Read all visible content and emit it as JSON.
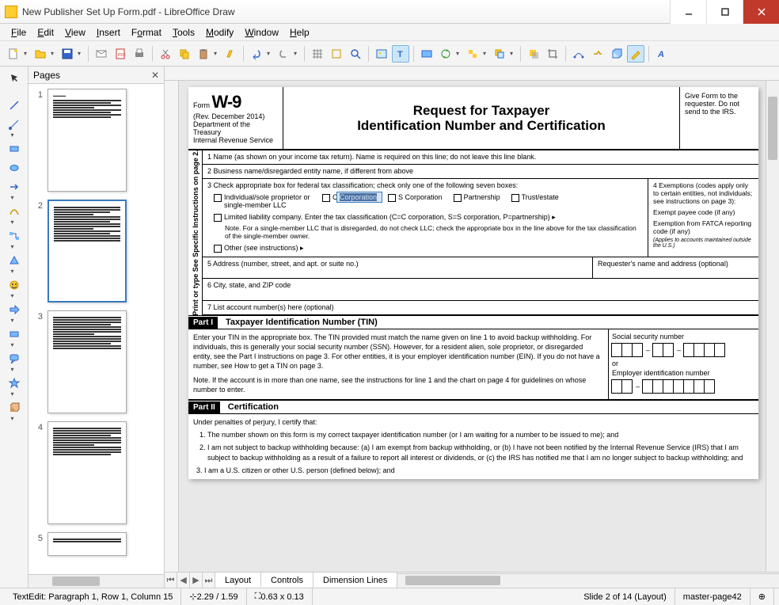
{
  "window": {
    "title": "New Publisher Set Up Form.pdf - LibreOffice Draw"
  },
  "menu": {
    "file": "File",
    "edit": "Edit",
    "view": "View",
    "insert": "Insert",
    "format": "Format",
    "tools": "Tools",
    "modify": "Modify",
    "window": "Window",
    "help": "Help"
  },
  "pages_panel": {
    "title": "Pages",
    "thumbs": [
      "1",
      "2",
      "3",
      "4",
      "5"
    ],
    "selected": 1
  },
  "tabs": {
    "layout": "Layout",
    "controls": "Controls",
    "dimension": "Dimension Lines"
  },
  "status": {
    "textedit": "TextEdit: Paragraph 1, Row 1, Column 15",
    "pos": "2.29 / 1.59",
    "size": "0.63 x 0.13",
    "slide": "Slide 2 of 14 (Layout)",
    "master": "master-page42"
  },
  "w9": {
    "form": "Form",
    "name": "W-9",
    "rev": "(Rev. December 2014)",
    "dept": "Department of the Treasury",
    "irs": "Internal Revenue Service",
    "title1": "Request for Taxpayer",
    "title2": "Identification Number and Certification",
    "give": "Give Form to the requester. Do not send to the IRS.",
    "side": "Print or type    See Specific Instructions on page 2.",
    "line1": "1  Name (as shown on your income tax return). Name is required on this line; do not leave this line blank.",
    "line2": "2  Business name/disregarded entity name, if different from above",
    "line3": "3  Check appropriate box for federal tax classification; check only one of the following seven boxes:",
    "box_ind": "Individual/sole proprietor or single-member LLC",
    "box_ccorp": "C Corporation",
    "box_scorp": "S Corporation",
    "box_part": "Partnership",
    "box_trust": "Trust/estate",
    "box_llc": "Limited liability company. Enter the tax classification (C=C corporation, S=S corporation, P=partnership) ▸",
    "llc_note": "Note. For a single-member LLC that is disregarded, do not check LLC; check the appropriate box in the line above for the tax classification of the single-member owner.",
    "box_other": "Other (see instructions) ▸",
    "line4": "4  Exemptions (codes apply only to certain entities, not individuals; see instructions on page 3):",
    "exempt1": "Exempt payee code (if any)",
    "exempt2": "Exemption from FATCA reporting code (if any)",
    "exempt3": "(Applies to accounts maintained outside the U.S.)",
    "line5": "5  Address (number, street, and apt. or suite no.)",
    "req_addr": "Requester's name and address (optional)",
    "line6": "6  City, state, and ZIP code",
    "line7": "7  List account number(s) here (optional)",
    "part1": "Part I",
    "part1_title": "Taxpayer Identification Number (TIN)",
    "tin_text1": "Enter your TIN in the appropriate box. The TIN provided must match the name given on line 1 to avoid backup withholding. For individuals, this is generally your social security number (SSN). However, for a resident alien, sole proprietor, or disregarded entity, see the Part I instructions on page 3. For other entities, it is your employer identification number (EIN). If you do not have a number, see How to get a TIN on page 3.",
    "tin_note": "Note. If the account is in more than one name, see the instructions for line 1 and the chart on page 4 for guidelines on whose number to enter.",
    "ssn": "Social security number",
    "or": "or",
    "ein": "Employer identification number",
    "part2": "Part II",
    "part2_title": "Certification",
    "cert_pre": "Under penalties of perjury, I certify that:",
    "cert1": "The number shown on this form is my correct taxpayer identification number (or I am waiting for a number to be issued to me); and",
    "cert2": "I am not subject to backup withholding because: (a) I am exempt from backup withholding, or (b) I have not been notified by the Internal Revenue Service (IRS) that I am subject to backup withholding as a result of a failure to report all interest or dividends, or (c) the IRS has notified me that I am no longer subject to backup withholding; and",
    "cert3": "I am a U.S. citizen or other U.S. person (defined below); and"
  }
}
